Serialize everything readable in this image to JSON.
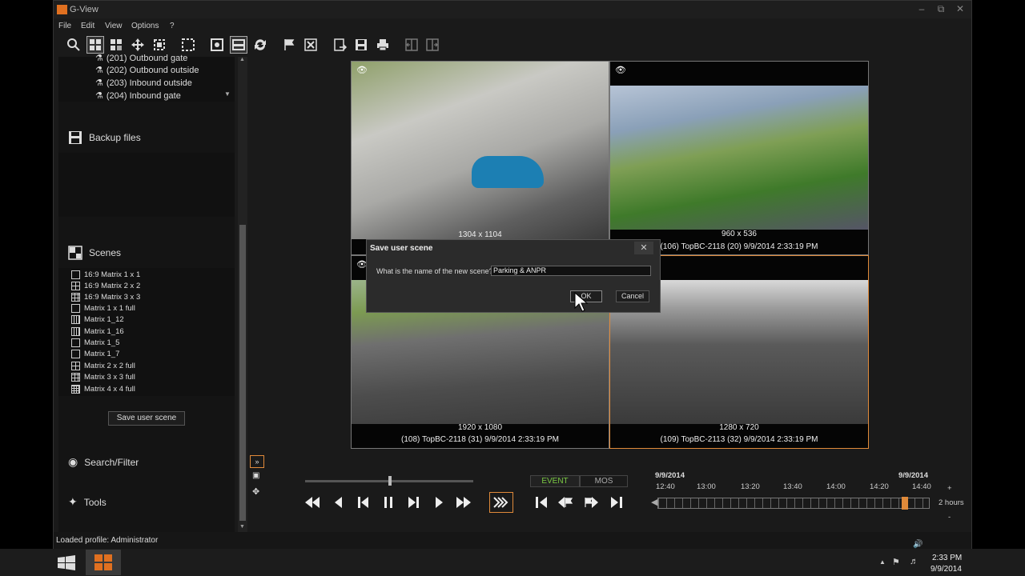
{
  "window": {
    "title": "G-View"
  },
  "menu": [
    "File",
    "Edit",
    "View",
    "Options",
    "?"
  ],
  "cameras": [
    "(201) Outbound gate",
    "(202) Outbound outside",
    "(203) Inbound outside",
    "(204) Inbound gate"
  ],
  "backup": {
    "title": "Backup files"
  },
  "scenes": {
    "title": "Scenes",
    "items": [
      "16:9 Matrix 1 x 1",
      "16:9 Matrix 2 x 2",
      "16:9 Matrix 3 x 3",
      "Matrix 1 x 1 full",
      "Matrix 1_12",
      "Matrix 1_16",
      "Matrix 1_5",
      "Matrix 1_7",
      "Matrix 2 x 2 full",
      "Matrix 3 x 3 full",
      "Matrix 4 x 4 full"
    ],
    "save_button": "Save user scene"
  },
  "search": {
    "title": "Search/Filter"
  },
  "tools": {
    "title": "Tools"
  },
  "tiles": [
    {
      "resolution": "1304 x 1104",
      "caption": ""
    },
    {
      "resolution": "960 x 536",
      "caption": "(106) TopBC-2118  (20)  9/9/2014 2:33:19 PM"
    },
    {
      "resolution": "1920 x 1080",
      "caption": "(108) TopBC-2118 (31)  9/9/2014 2:33:19 PM"
    },
    {
      "resolution": "1280 x 720",
      "caption": "(109) TopBC-2113 (32)  9/9/2014 2:33:19 PM"
    }
  ],
  "dialog": {
    "title": "Save user scene",
    "question": "What is the name of the new scene?",
    "input_value": "Parking & ANPR",
    "ok": "OK",
    "cancel": "Cancel"
  },
  "playback": {
    "event_tab": "EVENT",
    "mos_tab": "MOS"
  },
  "timeline": {
    "date_left": "9/9/2014",
    "date_right": "9/9/2014",
    "ticks": [
      "12:40",
      "13:00",
      "13:20",
      "13:40",
      "14:00",
      "14:20",
      "14:40"
    ],
    "zoom_in": "+",
    "range": "2 hours",
    "zoom_out": "-",
    "position": 0.91
  },
  "status": {
    "text": "Loaded profile: Administrator"
  },
  "taskbar": {
    "time": "2:33 PM",
    "date": "9/9/2014"
  },
  "colors": {
    "accent": "#e08a3a",
    "event_green": "#7ac943"
  }
}
